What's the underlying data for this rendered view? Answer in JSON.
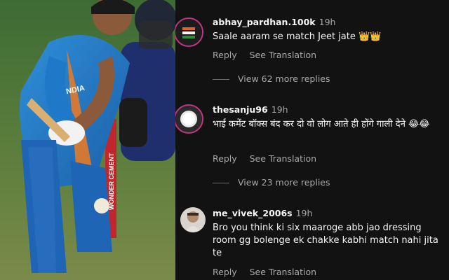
{
  "photo": {
    "jersey_number_text": "",
    "board_text": "WONDER CEMENT",
    "jersey_text": "INDIA"
  },
  "comments": [
    {
      "username": "abhay_pardhan.100k",
      "time": "19h",
      "text": "Saale aaram se match Jeet jate 👑👑",
      "reply_label": "Reply",
      "translate_label": "See Translation",
      "view_replies": "View 62 more replies"
    },
    {
      "username": "thesanju96",
      "time": "19h",
      "text": "भाई कमेंट बॉक्स बंद कर दो वो लोग आते ही होंगे गाली देने 😂😂",
      "reply_label": "Reply",
      "translate_label": "See Translation",
      "view_replies": "View 23 more replies"
    },
    {
      "username": "me_vivek_2006s",
      "time": "19h",
      "text": "Bro you think ki six maaroge abb jao dressing room gg bolenge ek chakke kabhi match nahi jita te",
      "reply_label": "Reply",
      "translate_label": "See Translation"
    }
  ],
  "colors": {
    "background": "#121212",
    "primary_text": "#f5f5f5",
    "secondary_text": "#a8a8a8"
  }
}
